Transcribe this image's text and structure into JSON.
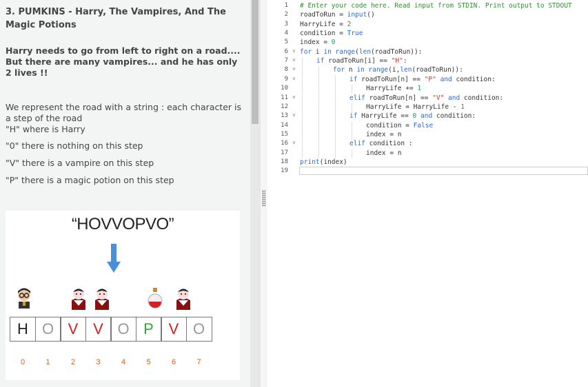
{
  "problem": {
    "title": "3. PUMKINS - Harry, The Vampires, And The Magic Potions",
    "intro": "Harry needs to go from left to right on a road.... But there are many vampires... and he has only 2 lives !!",
    "represent": "We represent the road with a string : each character is a step of the road",
    "h_line": "\"H\" where is Harry",
    "o_line": "\"0\"  there is nothing on this step",
    "v_line": "\"V\"  there is a vampire on this step",
    "p_line": "\"P\"  there is a magic potion on this step"
  },
  "figure": {
    "road_string": "“HOVVOPVO”",
    "cells": [
      "H",
      "O",
      "V",
      "V",
      "O",
      "P",
      "V",
      "O"
    ],
    "indices": [
      "0",
      "1",
      "2",
      "3",
      "4",
      "5",
      "6",
      "7"
    ],
    "colors": {
      "H": "#222222",
      "O": "#999999",
      "V": "#d42020",
      "P": "#3aa43a",
      "arrow": "#4a90d9",
      "index": "#e05a1a"
    }
  },
  "editor": {
    "lines": [
      {
        "n": "1",
        "fold": "",
        "indent": 0,
        "html": "<span class='cmt'># Enter your code here. Read input from STDIN. Print output to STDOUT</span>"
      },
      {
        "n": "2",
        "fold": "",
        "indent": 0,
        "html": "roadToRun = <span class='kw'>input</span>()"
      },
      {
        "n": "3",
        "fold": "",
        "indent": 0,
        "html": "HarryLife = <span class='num'>2</span>"
      },
      {
        "n": "4",
        "fold": "",
        "indent": 0,
        "html": "condition = <span class='kw'>True</span>"
      },
      {
        "n": "5",
        "fold": "",
        "indent": 0,
        "html": "index = <span class='num'>0</span>"
      },
      {
        "n": "6",
        "fold": "v",
        "indent": 0,
        "html": "<span class='kw'>for</span> i <span class='kw'>in</span> <span class='kw'>range</span>(<span class='kw'>len</span>(roadToRun)):"
      },
      {
        "n": "7",
        "fold": "v",
        "indent": 1,
        "html": "<span class='kw'>if</span> roadToRun[i] == <span class='str'>\"H\"</span>:"
      },
      {
        "n": "8",
        "fold": "v",
        "indent": 2,
        "html": "<span class='kw'>for</span> n <span class='kw'>in</span> <span class='kw'>range</span>(i,<span class='kw'>len</span>(roadToRun)):"
      },
      {
        "n": "9",
        "fold": "v",
        "indent": 3,
        "html": "<span class='kw'>if</span> roadToRun[n] == <span class='str'>\"P\"</span> <span class='kw'>and</span> condition:"
      },
      {
        "n": "10",
        "fold": "",
        "indent": 4,
        "html": "HarryLife += <span class='num'>1</span>"
      },
      {
        "n": "11",
        "fold": "v",
        "indent": 3,
        "html": "<span class='kw'>elif</span> roadToRun[n] == <span class='str'>\"V\"</span> <span class='kw'>and</span> condition:"
      },
      {
        "n": "12",
        "fold": "",
        "indent": 4,
        "html": "HarryLife = HarryLife - <span class='num'>1</span>"
      },
      {
        "n": "13",
        "fold": "v",
        "indent": 3,
        "html": "<span class='kw'>if</span> HarryLife == <span class='num'>0</span> <span class='kw'>and</span> condition:"
      },
      {
        "n": "14",
        "fold": "",
        "indent": 4,
        "html": "condition = <span class='kw'>False</span>"
      },
      {
        "n": "15",
        "fold": "",
        "indent": 4,
        "html": "index = n"
      },
      {
        "n": "16",
        "fold": "v",
        "indent": 3,
        "html": "<span class='kw'>elif</span> condition :"
      },
      {
        "n": "17",
        "fold": "",
        "indent": 4,
        "html": "index = n"
      },
      {
        "n": "18",
        "fold": "",
        "indent": 0,
        "html": "<span class='kw'>print</span>(index)"
      },
      {
        "n": "19",
        "fold": "",
        "indent": 0,
        "html": ""
      }
    ]
  }
}
